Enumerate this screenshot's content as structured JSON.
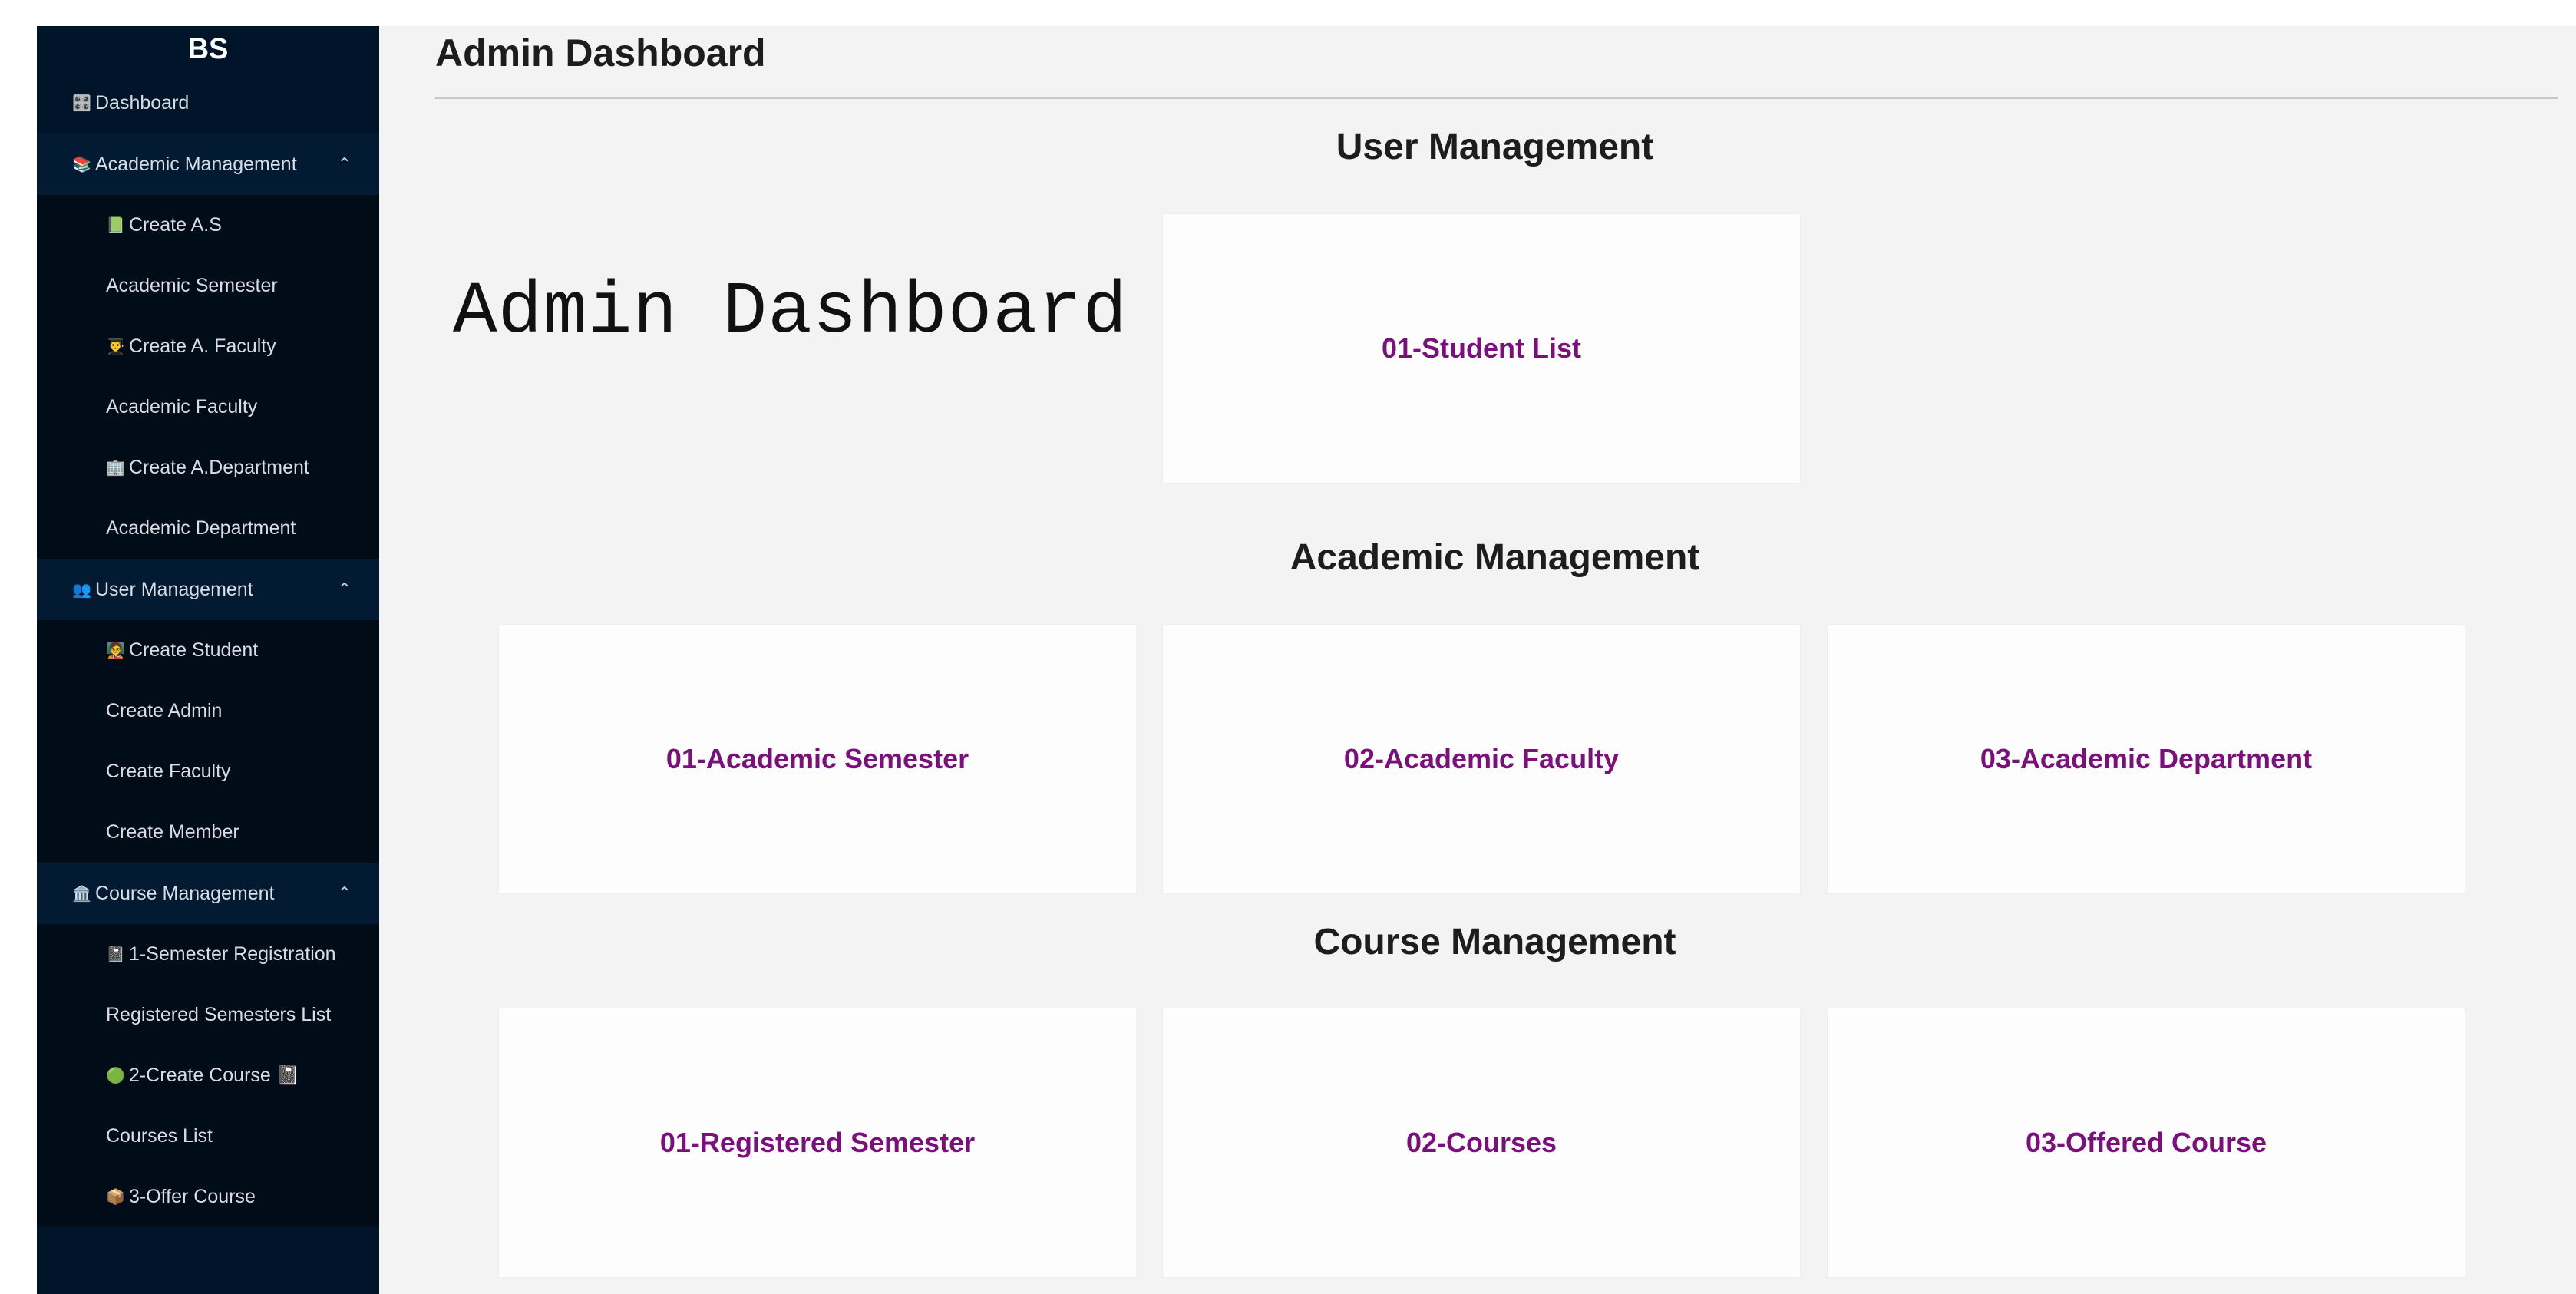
{
  "sidebar": {
    "logo": "BS",
    "dashboard": {
      "icon": "🎛️",
      "label": "Dashboard"
    },
    "academic": {
      "icon": "📚",
      "label": "Academic Management",
      "items": [
        {
          "icon": "📗",
          "label": "Create A.S"
        },
        {
          "icon": "",
          "label": "Academic Semester"
        },
        {
          "icon": "👨‍🎓",
          "label": "Create A. Faculty"
        },
        {
          "icon": "",
          "label": "Academic Faculty"
        },
        {
          "icon": "🏢",
          "label": "Create A.Department"
        },
        {
          "icon": "",
          "label": "Academic Department"
        }
      ]
    },
    "user": {
      "icon": "👥",
      "label": "User Management",
      "items": [
        {
          "icon": "🧑‍🏫",
          "label": "Create Student"
        },
        {
          "icon": "",
          "label": "Create Admin"
        },
        {
          "icon": "",
          "label": "Create Faculty"
        },
        {
          "icon": "",
          "label": "Create Member"
        }
      ]
    },
    "course": {
      "icon": "🏛️",
      "label": "Course Management",
      "items": [
        {
          "icon": "📓",
          "label": "1-Semester Registration"
        },
        {
          "icon": "",
          "label": "Registered Semesters List"
        },
        {
          "icon": "🟢",
          "label": "2-Create Course 📓"
        },
        {
          "icon": "",
          "label": "Courses List"
        },
        {
          "icon": "📦",
          "label": "3-Offer Course"
        }
      ]
    },
    "caret": "⌃"
  },
  "main": {
    "page_title": "Admin Dashboard",
    "big_title": "Admin Dashboard",
    "sections": {
      "user": {
        "title": "User Management",
        "cards": [
          "01-Student List"
        ]
      },
      "academic": {
        "title": "Academic Management",
        "cards": [
          "01-Academic Semester",
          "02-Academic Faculty",
          "03-Academic Department"
        ]
      },
      "course": {
        "title": "Course Management",
        "cards": [
          "01-Registered Semester",
          "02-Courses",
          "03-Offered Course"
        ]
      }
    }
  },
  "colors": {
    "sidebar": "#001529",
    "accent": "#7b0f7b",
    "background": "#f3f3f3"
  }
}
